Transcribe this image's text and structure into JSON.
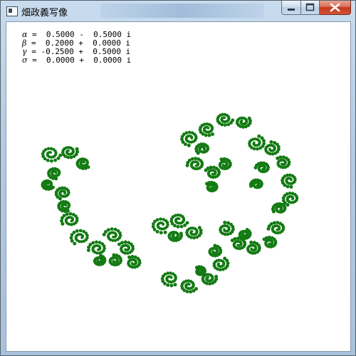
{
  "window": {
    "title": "畑政義写像",
    "accent": "#c4391c"
  },
  "parameters": [
    {
      "symbol": "α",
      "text": " =  0.5000 -  0.5000 i"
    },
    {
      "symbol": "β",
      "text": " =  0.2000 +  0.0000 i"
    },
    {
      "symbol": "γ",
      "text": " = -0.2500 +  0.5000 i"
    },
    {
      "symbol": "σ",
      "text": " =  0.0000 +  0.0000 i"
    }
  ],
  "plot": {
    "dot_color": "#137a13",
    "icons": {
      "minimize": "minimize-icon",
      "maximize": "maximize-icon",
      "close": "close-icon"
    }
  }
}
